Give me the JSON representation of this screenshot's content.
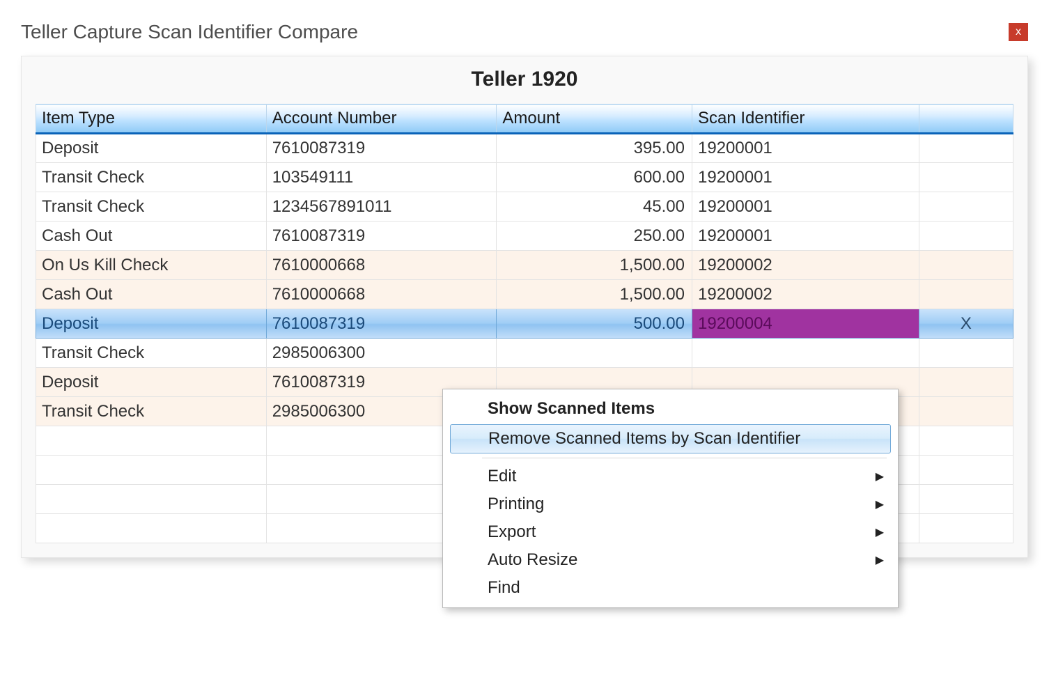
{
  "window": {
    "title": "Teller Capture Scan Identifier Compare",
    "close_glyph": "x"
  },
  "header": {
    "subtitle": "Teller 1920"
  },
  "table": {
    "columns": {
      "item_type": "Item Type",
      "account_number": "Account Number",
      "amount": "Amount",
      "scan_identifier": "Scan Identifier",
      "action": ""
    },
    "rows": [
      {
        "item_type": "Deposit",
        "account_number": "7610087319",
        "amount": "395.00",
        "scan_identifier": "19200001",
        "xcell": "",
        "alt": false,
        "selected": false
      },
      {
        "item_type": "Transit Check",
        "account_number": "103549111",
        "amount": "600.00",
        "scan_identifier": "19200001",
        "xcell": "",
        "alt": false,
        "selected": false
      },
      {
        "item_type": "Transit Check",
        "account_number": "1234567891011",
        "amount": "45.00",
        "scan_identifier": "19200001",
        "xcell": "",
        "alt": false,
        "selected": false
      },
      {
        "item_type": "Cash Out",
        "account_number": "7610087319",
        "amount": "250.00",
        "scan_identifier": "19200001",
        "xcell": "",
        "alt": false,
        "selected": false
      },
      {
        "item_type": "On Us Kill Check",
        "account_number": "7610000668",
        "amount": "1,500.00",
        "scan_identifier": "19200002",
        "xcell": "",
        "alt": true,
        "selected": false
      },
      {
        "item_type": "Cash Out",
        "account_number": "7610000668",
        "amount": "1,500.00",
        "scan_identifier": "19200002",
        "xcell": "",
        "alt": true,
        "selected": false
      },
      {
        "item_type": "Deposit",
        "account_number": "7610087319",
        "amount": "500.00",
        "scan_identifier": "19200004",
        "xcell": "X",
        "alt": false,
        "selected": true
      },
      {
        "item_type": "Transit Check",
        "account_number": "2985006300",
        "amount": "",
        "scan_identifier": "",
        "xcell": "",
        "alt": false,
        "selected": false
      },
      {
        "item_type": "Deposit",
        "account_number": "7610087319",
        "amount": "",
        "scan_identifier": "",
        "xcell": "",
        "alt": true,
        "selected": false
      },
      {
        "item_type": "Transit Check",
        "account_number": "2985006300",
        "amount": "",
        "scan_identifier": "",
        "xcell": "",
        "alt": true,
        "selected": false
      }
    ],
    "blank_rows": 4
  },
  "context_menu": {
    "items": [
      {
        "label": "Show Scanned Items",
        "bold": true,
        "submenu": false,
        "highlight": false
      },
      {
        "label": "Remove Scanned Items by Scan Identifier",
        "bold": false,
        "submenu": false,
        "highlight": true
      },
      {
        "separator": true
      },
      {
        "label": "Edit",
        "bold": false,
        "submenu": true,
        "highlight": false
      },
      {
        "label": "Printing",
        "bold": false,
        "submenu": true,
        "highlight": false
      },
      {
        "label": "Export",
        "bold": false,
        "submenu": true,
        "highlight": false
      },
      {
        "label": "Auto Resize",
        "bold": false,
        "submenu": true,
        "highlight": false
      },
      {
        "label": "Find",
        "bold": false,
        "submenu": false,
        "highlight": false
      }
    ],
    "arrow_glyph": "▶"
  }
}
